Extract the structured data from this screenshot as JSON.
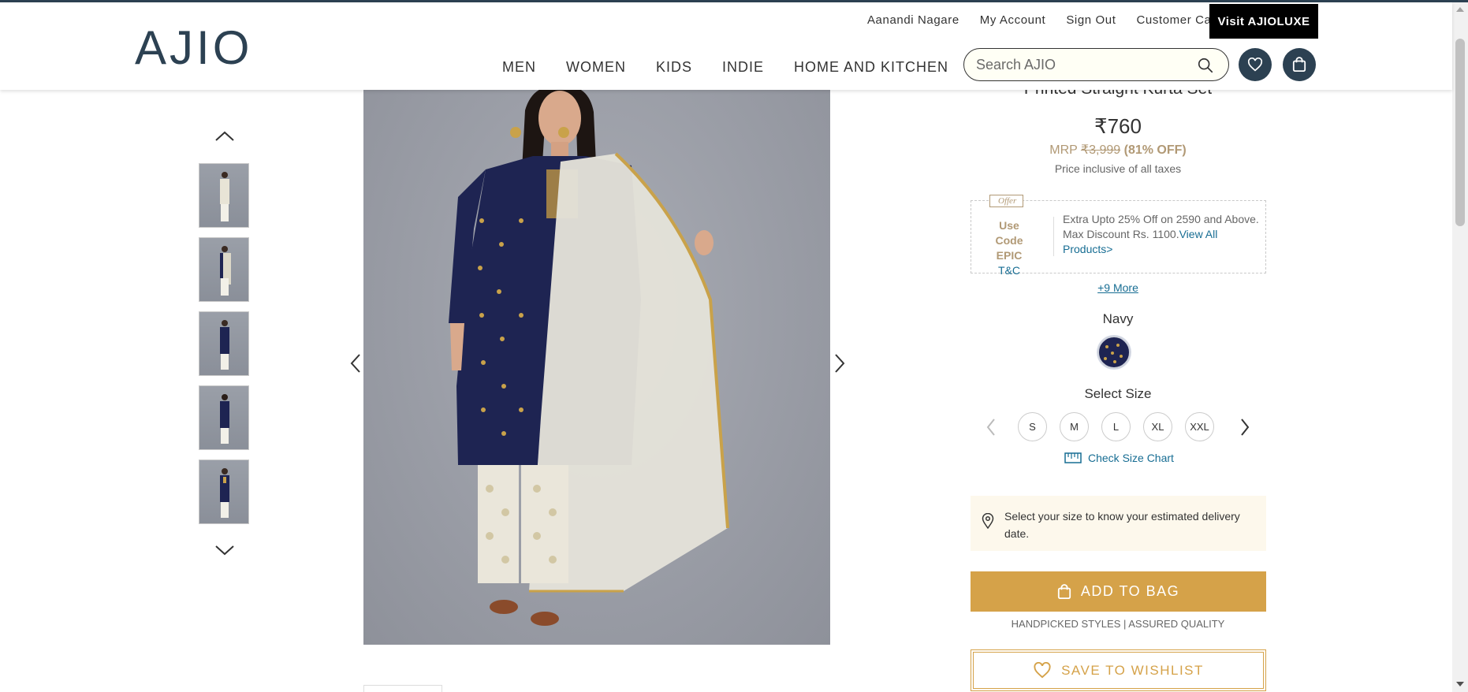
{
  "header": {
    "logo": "AJIO",
    "top_links": {
      "user": "Aanandi Nagare",
      "account": "My Account",
      "signout": "Sign Out",
      "care": "Customer Care"
    },
    "luxe_button": "Visit AJIOLUXE",
    "nav": {
      "men": "MEN",
      "women": "WOMEN",
      "kids": "KIDS",
      "indie": "INDIE",
      "home": "HOME AND KITCHEN"
    },
    "search": {
      "placeholder": "Search AJIO"
    }
  },
  "product": {
    "title": "Printed Straight Kurta Set",
    "price": "₹760",
    "mrp_label": "MRP",
    "mrp_value": "₹3,999",
    "discount": "(81% OFF)",
    "tax_note": "Price inclusive of all taxes",
    "offer": {
      "tag": "Offer",
      "use_code": "Use Code",
      "code": "EPIC",
      "tc": "T&C",
      "text": "Extra Upto 25% Off on 2590 and Above. Max Discount Rs. 1100.",
      "link": "View All Products>"
    },
    "more_offers": "+9 More",
    "color_name": "Navy",
    "colors": {
      "navy": "#1e2452",
      "accent_gold": "#d5a249",
      "link_blue": "#176d93",
      "brand_dark": "#2c4152"
    },
    "select_size_label": "Select Size",
    "sizes": [
      "S",
      "M",
      "L",
      "XL",
      "XXL"
    ],
    "size_chart": "Check Size Chart",
    "delivery_note": "Select your size to know your estimated delivery date.",
    "add_to_bag": "ADD TO BAG",
    "assured": "HANDPICKED STYLES | ASSURED QUALITY",
    "wishlist": "SAVE TO WISHLIST"
  },
  "icons": {
    "search": "search-icon",
    "wishlist": "heart-icon",
    "bag": "shopping-bag-icon",
    "location": "location-pin-icon",
    "ruler": "ruler-icon"
  }
}
